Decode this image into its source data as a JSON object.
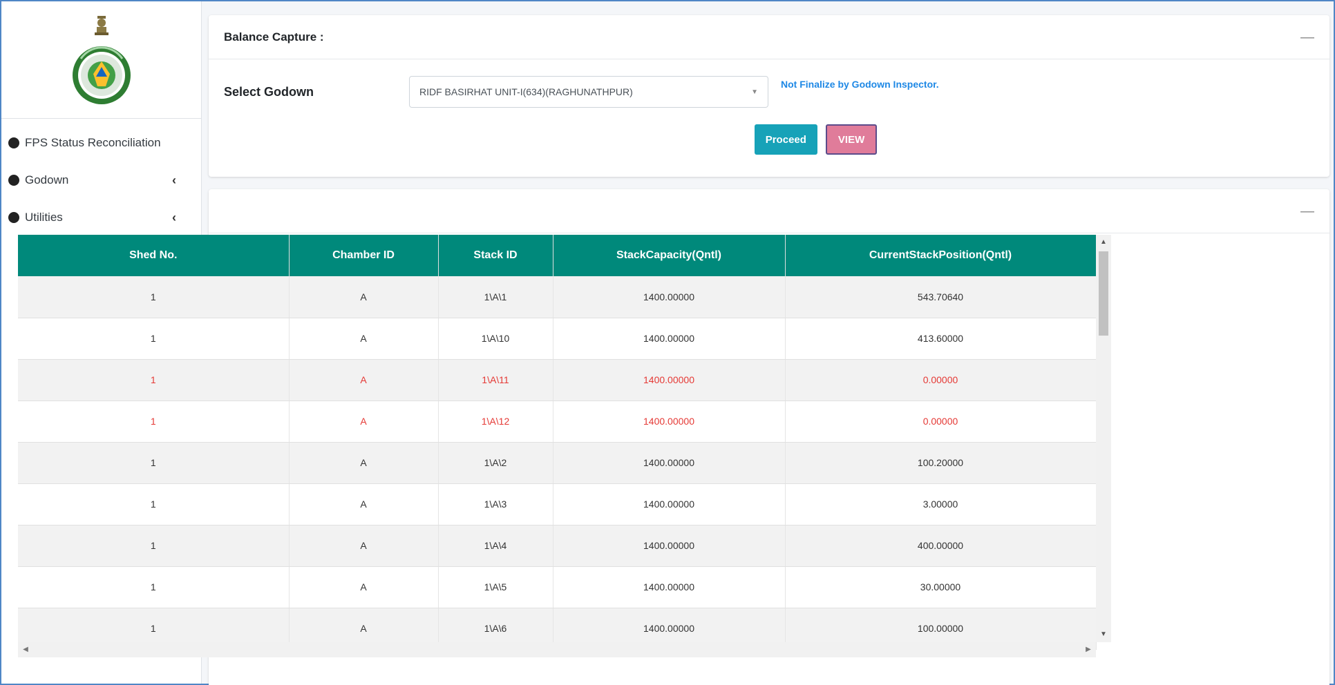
{
  "sidebar": {
    "items": [
      {
        "label": "FPS Status Reconciliation",
        "has_arrow": false
      },
      {
        "label": "Godown",
        "has_arrow": true
      },
      {
        "label": "Utilities",
        "has_arrow": true
      }
    ],
    "arrow_glyph": "‹"
  },
  "balance_capture": {
    "title": "Balance Capture :",
    "collapse_glyph": "—",
    "select_label": "Select Godown",
    "select_value": "RIDF BASIRHAT UNIT-I(634)(RAGHUNATHPUR)",
    "status_text": "Not Finalize by Godown Inspector.",
    "proceed_label": "Proceed",
    "view_label": "VIEW"
  },
  "stack_panel": {
    "collapse_glyph": "—"
  },
  "table": {
    "columns": [
      "Shed No.",
      "Chamber ID",
      "Stack ID",
      "StackCapacity(Qntl)",
      "CurrentStackPosition(Qntl)"
    ],
    "rows": [
      {
        "shed": "1",
        "chamber": "A",
        "stack": "1\\A\\1",
        "capacity": "1400.00000",
        "position": "543.70640",
        "highlight": false
      },
      {
        "shed": "1",
        "chamber": "A",
        "stack": "1\\A\\10",
        "capacity": "1400.00000",
        "position": "413.60000",
        "highlight": false
      },
      {
        "shed": "1",
        "chamber": "A",
        "stack": "1\\A\\11",
        "capacity": "1400.00000",
        "position": "0.00000",
        "highlight": true
      },
      {
        "shed": "1",
        "chamber": "A",
        "stack": "1\\A\\12",
        "capacity": "1400.00000",
        "position": "0.00000",
        "highlight": true
      },
      {
        "shed": "1",
        "chamber": "A",
        "stack": "1\\A\\2",
        "capacity": "1400.00000",
        "position": "100.20000",
        "highlight": false
      },
      {
        "shed": "1",
        "chamber": "A",
        "stack": "1\\A\\3",
        "capacity": "1400.00000",
        "position": "3.00000",
        "highlight": false
      },
      {
        "shed": "1",
        "chamber": "A",
        "stack": "1\\A\\4",
        "capacity": "1400.00000",
        "position": "400.00000",
        "highlight": false
      },
      {
        "shed": "1",
        "chamber": "A",
        "stack": "1\\A\\5",
        "capacity": "1400.00000",
        "position": "30.00000",
        "highlight": false
      },
      {
        "shed": "1",
        "chamber": "A",
        "stack": "1\\A\\6",
        "capacity": "1400.00000",
        "position": "100.00000",
        "highlight": false
      }
    ]
  },
  "colors": {
    "header_teal": "#00897b",
    "proceed": "#17a2b8",
    "view": "#e07c9a",
    "status_blue": "#1e88e5",
    "highlight_red": "#e53935"
  }
}
